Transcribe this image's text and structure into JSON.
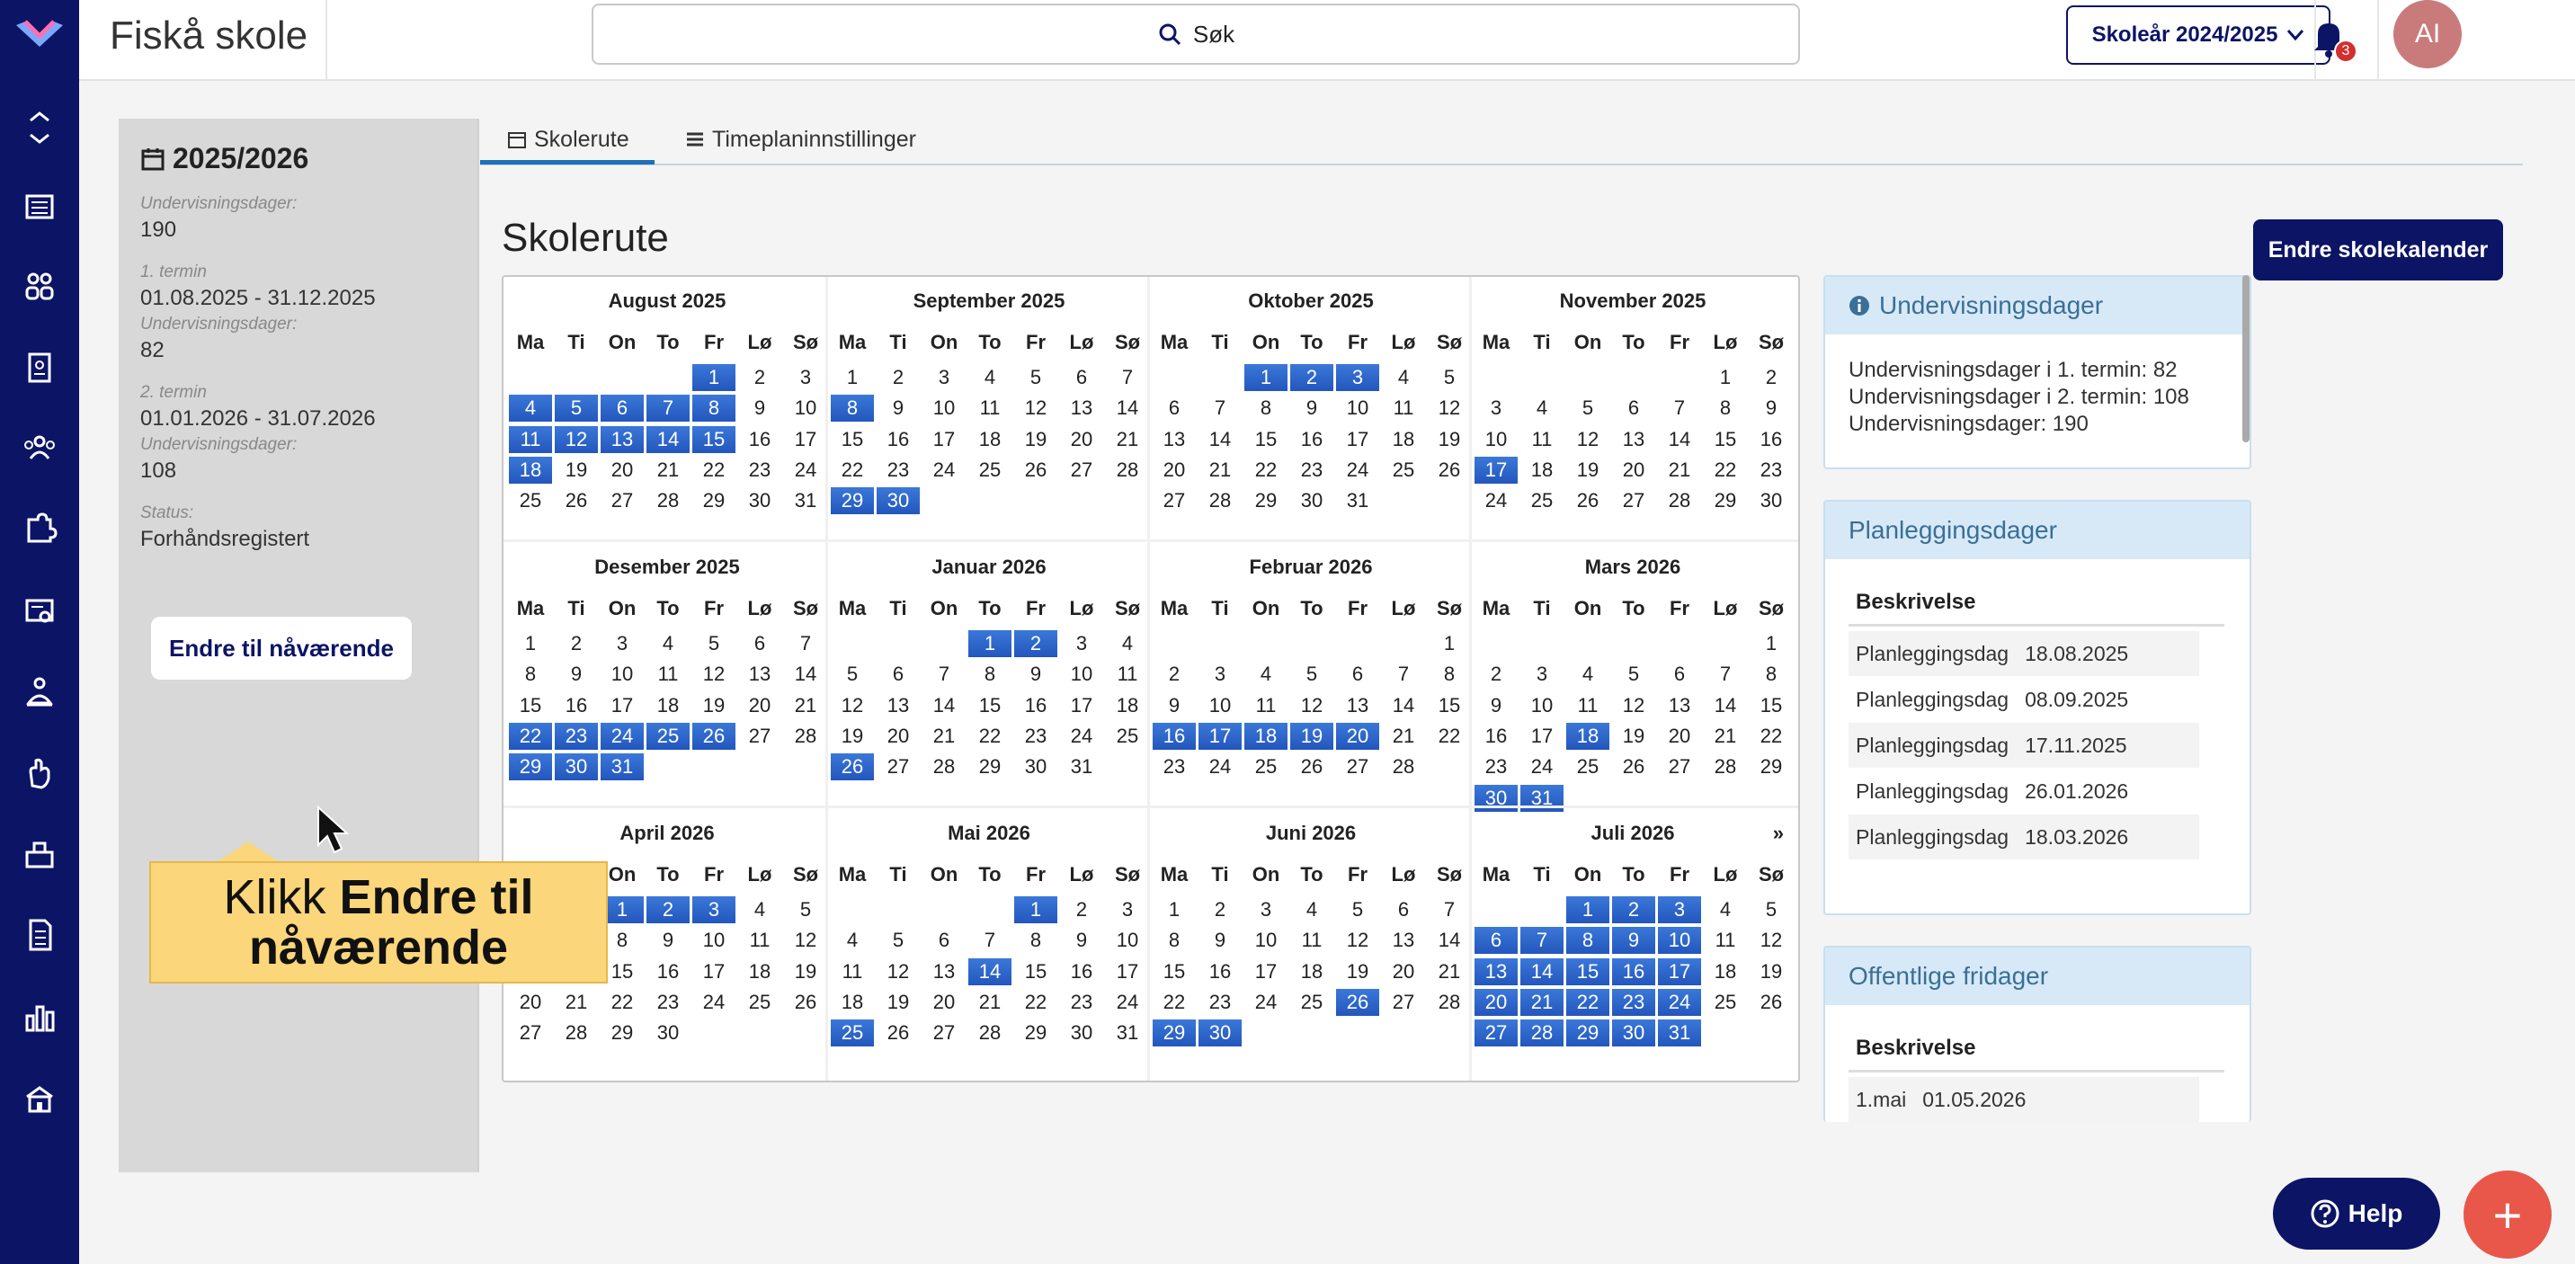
{
  "header": {
    "school": "Fiskå skole",
    "search_label": "Søk",
    "year_button": "Skoleår 2024/2025",
    "notif_count": "3",
    "avatar": "AI"
  },
  "nav": {
    "icons": [
      "expand-icon",
      "news-icon",
      "groups-icon",
      "clipboard-icon",
      "people-icon",
      "puzzle-icon",
      "certificate-icon",
      "person-icon",
      "hand-icon",
      "inbox-icon",
      "document-icon",
      "chart-icon",
      "school-icon"
    ]
  },
  "left": {
    "year": "2025/2026",
    "d_label": "Undervisningsdager:",
    "d_value": "190",
    "t1_label": "1. termin",
    "t1_value": "01.08.2025 - 31.12.2025",
    "t1d_label": "Undervisningsdager:",
    "t1d_value": "82",
    "t2_label": "2. termin",
    "t2_value": "01.01.2026 - 31.07.2026",
    "t2d_label": "Undervisningsdager:",
    "t2d_value": "108",
    "status_label": "Status:",
    "status_value": "Forhåndsregistert",
    "button": "Endre til nåværende"
  },
  "tabs": {
    "t1": "Skolerute",
    "t2": "Timeplaninnstillinger"
  },
  "title": "Skolerute",
  "edit_button": "Endre skolekalender",
  "weekdays": [
    "Ma",
    "Ti",
    "On",
    "To",
    "Fr",
    "Lø",
    "Sø"
  ],
  "next_arrow": "»",
  "months": [
    {
      "name": "August 2025",
      "offset": 4,
      "days": 31,
      "hl": [
        1,
        4,
        5,
        6,
        7,
        8,
        11,
        12,
        13,
        14,
        15,
        18
      ]
    },
    {
      "name": "September 2025",
      "offset": 0,
      "days": 30,
      "hl": [
        8,
        29,
        30
      ]
    },
    {
      "name": "Oktober 2025",
      "offset": 2,
      "days": 31,
      "hl": [
        1,
        2,
        3
      ]
    },
    {
      "name": "November 2025",
      "offset": 5,
      "days": 30,
      "hl": [
        17
      ]
    },
    {
      "name": "Desember 2025",
      "offset": 0,
      "days": 31,
      "hl": [
        22,
        23,
        24,
        25,
        26,
        29,
        30,
        31
      ]
    },
    {
      "name": "Januar 2026",
      "offset": 3,
      "days": 31,
      "hl": [
        1,
        2,
        26
      ]
    },
    {
      "name": "Februar 2026",
      "offset": 6,
      "days": 28,
      "hl": [
        16,
        17,
        18,
        19,
        20
      ]
    },
    {
      "name": "Mars 2026",
      "offset": 6,
      "days": 31,
      "hl": [
        18,
        30,
        31
      ]
    },
    {
      "name": "April 2026",
      "offset": 2,
      "days": 30,
      "hl": [
        1,
        2,
        3
      ]
    },
    {
      "name": "Mai 2026",
      "offset": 4,
      "days": 31,
      "hl": [
        1,
        14,
        25
      ]
    },
    {
      "name": "Juni 2026",
      "offset": 0,
      "days": 30,
      "hl": [
        26,
        29,
        30
      ]
    },
    {
      "name": "Juli 2026",
      "offset": 2,
      "days": 31,
      "hl": [
        1,
        2,
        3,
        6,
        7,
        8,
        9,
        10,
        13,
        14,
        15,
        16,
        17,
        20,
        21,
        22,
        23,
        24,
        27,
        28,
        29,
        30,
        31
      ]
    }
  ],
  "panel1": {
    "title": "Undervisningsdager",
    "lines": [
      "Undervisningsdager i 1. termin: 82",
      "Undervisningsdager i 2. termin: 108",
      "Undervisningsdager: 190"
    ]
  },
  "panel2": {
    "title": "Planleggingsdager",
    "header": "Beskrivelse",
    "rows": [
      [
        "Planleggingsdag",
        "18.08.2025"
      ],
      [
        "Planleggingsdag",
        "08.09.2025"
      ],
      [
        "Planleggingsdag",
        "17.11.2025"
      ],
      [
        "Planleggingsdag",
        "26.01.2026"
      ],
      [
        "Planleggingsdag",
        "18.03.2026"
      ]
    ]
  },
  "panel3": {
    "title": "Offentlige fridager",
    "header": "Beskrivelse",
    "rows": [
      [
        "1.mai",
        "01.05.2026"
      ]
    ]
  },
  "tooltip": {
    "pre": "Klikk ",
    "bold": "Endre til nåværende"
  },
  "help": "Help",
  "plus": "+",
  "colors": {
    "nav": "#0c1466",
    "highlight": "#2b62c8",
    "accent": "#e8574a"
  }
}
